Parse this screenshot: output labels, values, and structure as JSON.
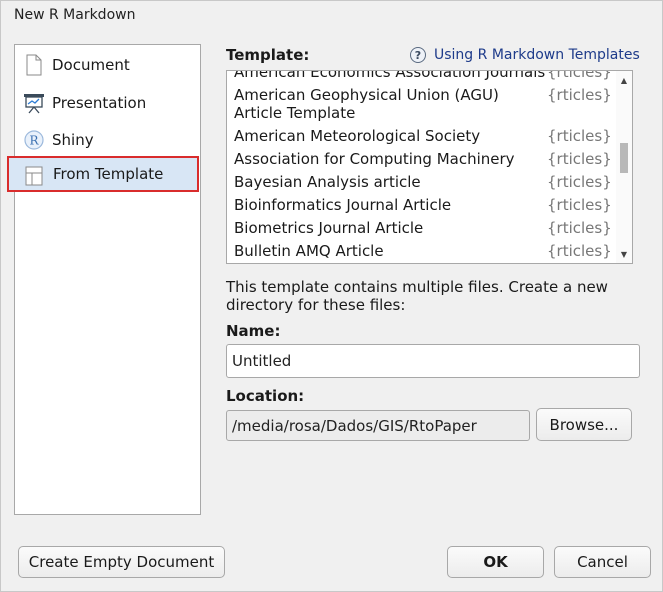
{
  "window": {
    "title": "New R Markdown"
  },
  "sidebar": {
    "items": [
      {
        "label": "Document",
        "icon": "document-icon"
      },
      {
        "label": "Presentation",
        "icon": "presentation-icon"
      },
      {
        "label": "Shiny",
        "icon": "shiny-icon"
      },
      {
        "label": "From Template",
        "icon": "template-icon",
        "selected": true
      }
    ]
  },
  "template": {
    "label": "Template:",
    "help_link": "Using R Markdown Templates",
    "items": [
      {
        "name": "American Economics Association Journals",
        "package": "{rticles}"
      },
      {
        "name": "American Geophysical Union (AGU)",
        "name2": "Article Template",
        "package": "{rticles}"
      },
      {
        "name": "American Meteorological Society",
        "package": "{rticles}"
      },
      {
        "name": "Association for Computing Machinery",
        "package": "{rticles}"
      },
      {
        "name": "Bayesian Analysis article",
        "package": "{rticles}"
      },
      {
        "name": "Bioinformatics Journal Article",
        "package": "{rticles}"
      },
      {
        "name": "Biometrics Journal Article",
        "package": "{rticles}"
      },
      {
        "name": "Bulletin AMQ Article",
        "package": "{rticles}"
      }
    ]
  },
  "description": "This template contains multiple files. Create a new directory for these files:",
  "name_field": {
    "label": "Name:",
    "value": "Untitled"
  },
  "location_field": {
    "label": "Location:",
    "value": "/media/rosa/Dados/GIS/RtoPaper",
    "browse_label": "Browse..."
  },
  "footer": {
    "create_empty_label": "Create Empty Document",
    "ok_label": "OK",
    "cancel_label": "Cancel"
  }
}
